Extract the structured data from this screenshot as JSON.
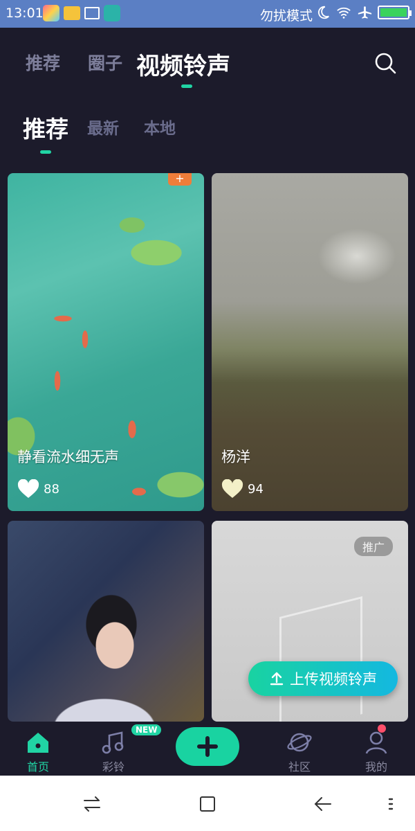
{
  "status_bar": {
    "time": "13:01",
    "dnd_text": "勿扰模式",
    "battery_level": 1.0
  },
  "top_tabs": [
    "推荐",
    "圈子",
    "视频铃声"
  ],
  "sub_tabs": [
    "推荐",
    "最新",
    "本地"
  ],
  "cards": [
    {
      "title": "静看流水细无声",
      "likes": "88",
      "corner_tag": "+"
    },
    {
      "title": "杨洋",
      "likes": "94"
    },
    {
      "title": ""
    },
    {
      "title": "",
      "badge": "推广"
    }
  ],
  "upload_button": {
    "label": "上传视频铃声"
  },
  "bottom_nav": {
    "home": "首页",
    "ringtone": "彩铃",
    "new_badge": "NEW",
    "community": "社区",
    "me": "我的"
  },
  "colors": {
    "accent": "#21d4a4",
    "background": "#1c1b2b",
    "status_bar": "#5b7fc4"
  }
}
